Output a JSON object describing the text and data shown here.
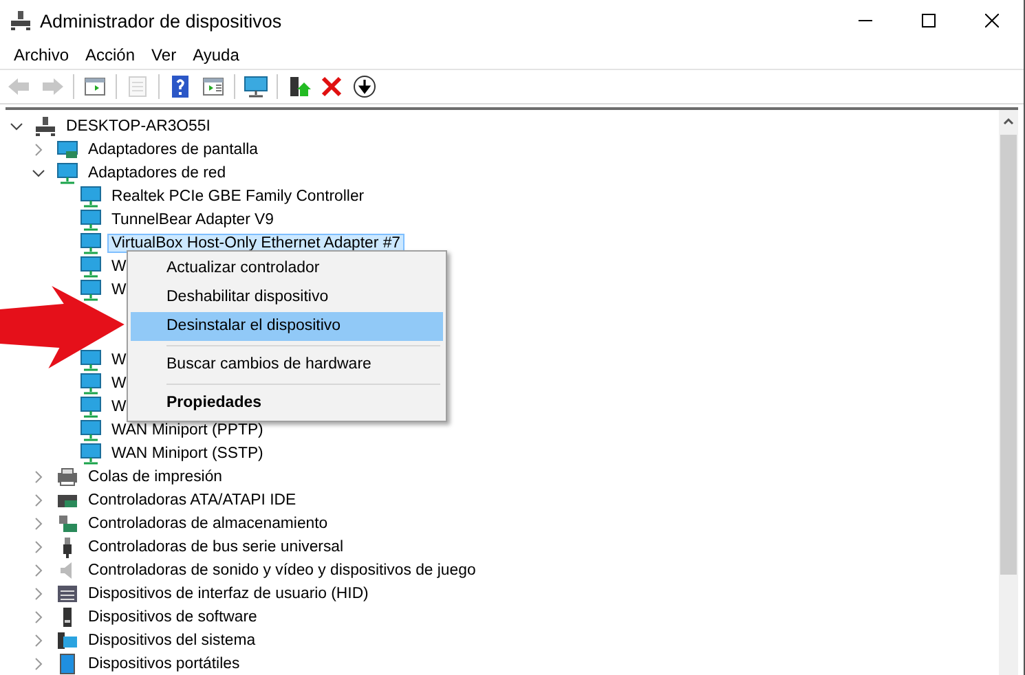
{
  "window": {
    "title": "Administrador de dispositivos"
  },
  "menu": [
    "Archivo",
    "Acción",
    "Ver",
    "Ayuda"
  ],
  "toolbar": [
    {
      "disabled": true
    },
    {
      "disabled": true
    },
    {
      "disabled": false
    },
    {
      "disabled": true
    },
    {
      "disabled": false
    },
    {
      "disabled": false
    },
    {
      "disabled": false
    },
    {
      "disabled": false
    },
    {
      "disabled": false
    },
    {
      "disabled": false
    }
  ],
  "tree": {
    "label": "DESKTOP-AR3O55I",
    "expanded": true,
    "children": [
      {
        "label": "Adaptadores de pantalla",
        "expanded": false
      },
      {
        "label": "Adaptadores de red",
        "expanded": true,
        "children": [
          {
            "label": "Realtek PCIe GBE Family Controller",
            "selected": false
          },
          {
            "label": "TunnelBear Adapter V9",
            "selected": false
          },
          {
            "label": "VirtualBox Host-Only Ethernet Adapter #7",
            "selected": true
          },
          {
            "label": "W",
            "selected": false
          },
          {
            "label": "W",
            "selected": false
          },
          {
            "kind": "covered",
            "selected": false
          },
          {
            "kind": "covered",
            "selected": false
          },
          {
            "label": "W",
            "selected": false
          },
          {
            "label": "W",
            "selected": false
          },
          {
            "label": "W",
            "selected": false
          },
          {
            "label": "WAN Miniport (PPTP)",
            "selected": false
          },
          {
            "label": "WAN Miniport (SSTP)",
            "selected": false
          }
        ]
      },
      {
        "label": "Colas de impresión",
        "expanded": false
      },
      {
        "label": "Controladoras ATA/ATAPI IDE",
        "expanded": false
      },
      {
        "label": "Controladoras de almacenamiento",
        "expanded": false
      },
      {
        "label": "Controladoras de bus serie universal",
        "expanded": false
      },
      {
        "label": "Controladoras de sonido y vídeo y dispositivos de juego",
        "expanded": false
      },
      {
        "label": "Dispositivos de interfaz de usuario (HID)",
        "expanded": false
      },
      {
        "label": "Dispositivos de software",
        "expanded": false
      },
      {
        "label": "Dispositivos del sistema",
        "expanded": false
      },
      {
        "label": "Dispositivos portátiles",
        "expanded": false
      }
    ]
  },
  "context_menu": [
    {
      "kind": "item",
      "label": "Actualizar controlador",
      "selected": false,
      "default": false
    },
    {
      "kind": "item",
      "label": "Deshabilitar dispositivo",
      "selected": false,
      "default": false
    },
    {
      "kind": "item",
      "label": "Desinstalar el dispositivo",
      "selected": true,
      "default": false
    },
    {
      "kind": "separator"
    },
    {
      "kind": "item",
      "label": "Buscar cambios de hardware",
      "selected": false,
      "default": false
    },
    {
      "kind": "separator"
    },
    {
      "kind": "item",
      "label": "Propiedades",
      "selected": false,
      "default": true
    }
  ]
}
